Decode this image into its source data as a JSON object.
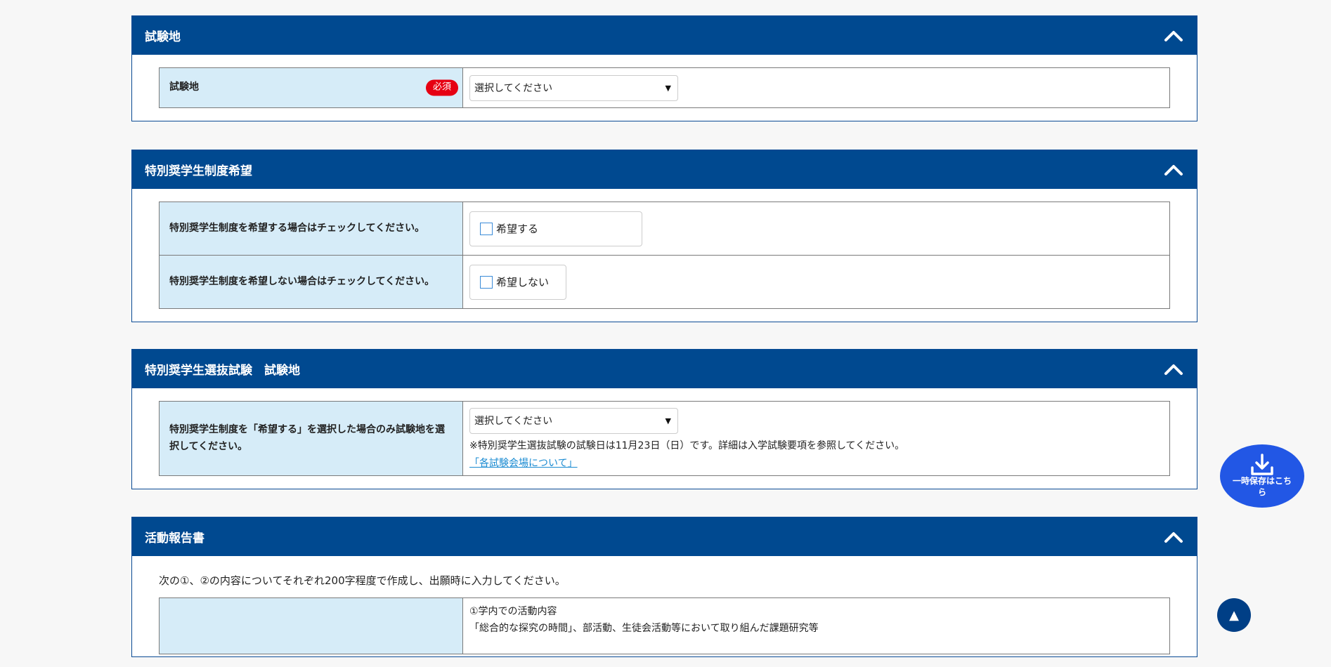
{
  "sections": [
    {
      "title": "試験地",
      "rows": [
        {
          "label": "試験地",
          "required": "必須",
          "select_value": "選択してください"
        }
      ]
    },
    {
      "title": "特別奨学生制度希望",
      "rows": [
        {
          "label": "特別奨学生制度を希望する場合はチェックしてください。",
          "checkbox_label": "希望する"
        },
        {
          "label": "特別奨学生制度を希望しない場合はチェックしてください。",
          "checkbox_label": "希望しない"
        }
      ]
    },
    {
      "title": "特別奨学生選抜試験　試験地",
      "rows": [
        {
          "label": "特別奨学生制度を「希望する」を選択した場合のみ試験地を選択してください。",
          "select_value": "選択してください",
          "note": "※特別奨学生選抜試験の試験日は11月23日（日）です。詳細は入学試験要項を参照してください。",
          "link": "「各試験会場について」"
        }
      ]
    },
    {
      "title": "活動報告書",
      "intro": "次の①、②の内容についてそれぞれ200字程度で作成し、出願時に入力してください。",
      "rows": [
        {
          "field_line1": "①学内での活動内容",
          "field_line2": "「総合的な探究の時間」、部活動、生徒会活動等において取り組んだ課題研究等"
        }
      ]
    }
  ],
  "float_save": {
    "label": "一時保存はこちら",
    "icon": "download-icon"
  },
  "float_top": {
    "label": "▲",
    "icon": "arrow-up-icon"
  },
  "colors": {
    "header": "#004990",
    "label_bg": "#d6ecf8",
    "required": "#e60012",
    "save_button": "#2257e5",
    "link": "#1a8bd2"
  }
}
